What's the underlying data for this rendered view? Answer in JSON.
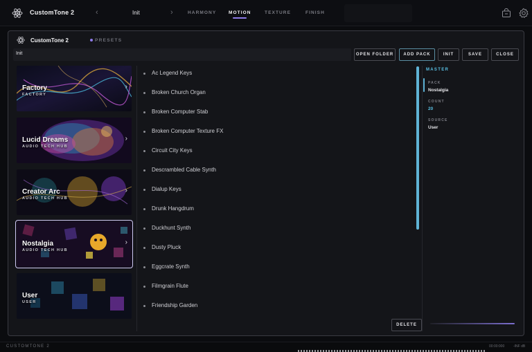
{
  "topbar": {
    "app_title": "CustomTone 2",
    "preset_name": "Init",
    "steps": [
      {
        "label": "HARMONY",
        "active": false
      },
      {
        "label": "MOTION",
        "active": true
      },
      {
        "label": "TEXTURE",
        "active": false
      },
      {
        "label": "FINISH",
        "active": false
      }
    ],
    "icons": [
      "atom-logo-icon",
      "chevron-left-icon",
      "chevron-right-icon",
      "store-icon",
      "settings-gear-icon"
    ]
  },
  "panel": {
    "title": "CustomTone 2",
    "section": "PRESETS",
    "path_value": "Init",
    "buttons": {
      "open_folder": "OPEN FOLDER",
      "add_pack": "ADD PACK",
      "init": "INIT",
      "save": "SAVE",
      "close": "CLOSE",
      "delete": "DELETE"
    },
    "packs": [
      {
        "name": "Factory",
        "sub": "FACTORY",
        "selected": false
      },
      {
        "name": "Lucid Dreams",
        "sub": "AUDIO TECH HUB",
        "selected": false
      },
      {
        "name": "Creator Arc",
        "sub": "AUDIO TECH HUB",
        "selected": false
      },
      {
        "name": "Nostalgia",
        "sub": "AUDIO TECH HUB",
        "selected": true
      },
      {
        "name": "User",
        "sub": "USER",
        "selected": false
      }
    ],
    "presets": [
      "Ac Legend Keys",
      "Broken Church Organ",
      "Broken Computer Stab",
      "Broken Computer Texture FX",
      "Circuit City Keys",
      "Descrambled Cable Synth",
      "Dialup Keys",
      "Drunk Hangdrum",
      "Duckhunt Synth",
      "Dusty Pluck",
      "Eggcrate Synth",
      "Filmgrain Flute",
      "Friendship Garden"
    ],
    "info": {
      "title": "MASTER",
      "pack_label": "PACK",
      "pack_value": "Nostalgia",
      "count_label": "COUNT",
      "count_value": "20",
      "source_label": "SOURCE",
      "source_value": "User"
    }
  },
  "bottombar": {
    "name": "CUSTOMTONE 2",
    "time": "00:00:000",
    "level": "-INF dB"
  },
  "colors": {
    "accent_purple": "#8f7bea",
    "accent_cyan": "#59c0e4",
    "background": "#0b0c0f",
    "panel": "#141519"
  }
}
